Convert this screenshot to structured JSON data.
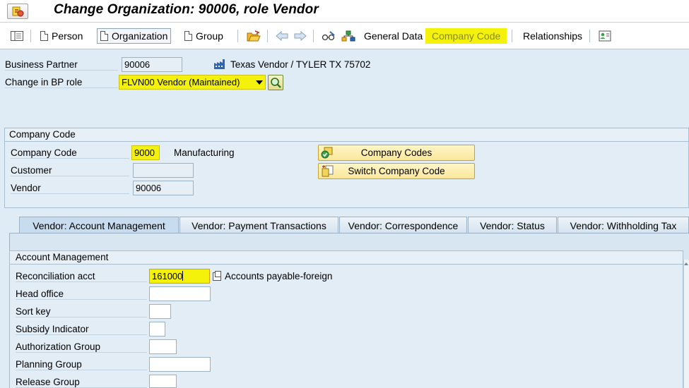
{
  "window": {
    "title": "Change Organization: 90006, role Vendor"
  },
  "toolbar": {
    "person_label": "Person",
    "organization_label": "Organization",
    "group_label": "Group",
    "general_data_label": "General Data",
    "company_code_label": "Company Code",
    "relationships_label": "Relationships"
  },
  "header": {
    "business_partner_label": "Business Partner",
    "business_partner_value": "90006",
    "partner_description": "Texas Vendor / TYLER TX 75702",
    "bp_role_label": "Change in BP role",
    "bp_role_value": "FLVN00 Vendor (Maintained)"
  },
  "company_code_group": {
    "title": "Company Code",
    "company_code_label": "Company Code",
    "company_code_value": "9000",
    "company_code_name": "Manufacturing",
    "customer_label": "Customer",
    "customer_value": "",
    "vendor_label": "Vendor",
    "vendor_value": "90006",
    "company_codes_button": "Company Codes",
    "switch_company_code_button": "Switch Company Code"
  },
  "tabs": [
    {
      "label": "Vendor: Account Management",
      "active": true
    },
    {
      "label": "Vendor: Payment Transactions",
      "active": false
    },
    {
      "label": "Vendor: Correspondence",
      "active": false
    },
    {
      "label": "Vendor: Status",
      "active": false
    },
    {
      "label": "Vendor: Withholding Tax",
      "active": false
    }
  ],
  "account_management": {
    "title": "Account Management",
    "reconciliation_label": "Reconciliation acct",
    "reconciliation_value": "161000",
    "reconciliation_description": "Accounts payable-foreign",
    "head_office_label": "Head office",
    "head_office_value": "",
    "sort_key_label": "Sort key",
    "sort_key_value": "",
    "subsidy_label": "Subsidy Indicator",
    "subsidy_value": "",
    "authorization_label": "Authorization Group",
    "authorization_value": "",
    "planning_label": "Planning Group",
    "planning_value": "",
    "release_label": "Release Group",
    "release_value": ""
  },
  "colors": {
    "highlight": "#f4f20a",
    "background": "#dfebf5",
    "button_yellow": "#fbe79a"
  },
  "icons": [
    "sap-logo-icon",
    "list-icon",
    "doc-icon",
    "open-folder-icon",
    "back-arrow-icon",
    "forward-arrow-icon",
    "glasses-icon",
    "hierarchy-icon",
    "address-card-icon",
    "building-icon",
    "dropdown-arrow-icon",
    "search-help-icon",
    "checkmark-doc-icon",
    "switch-icon"
  ]
}
